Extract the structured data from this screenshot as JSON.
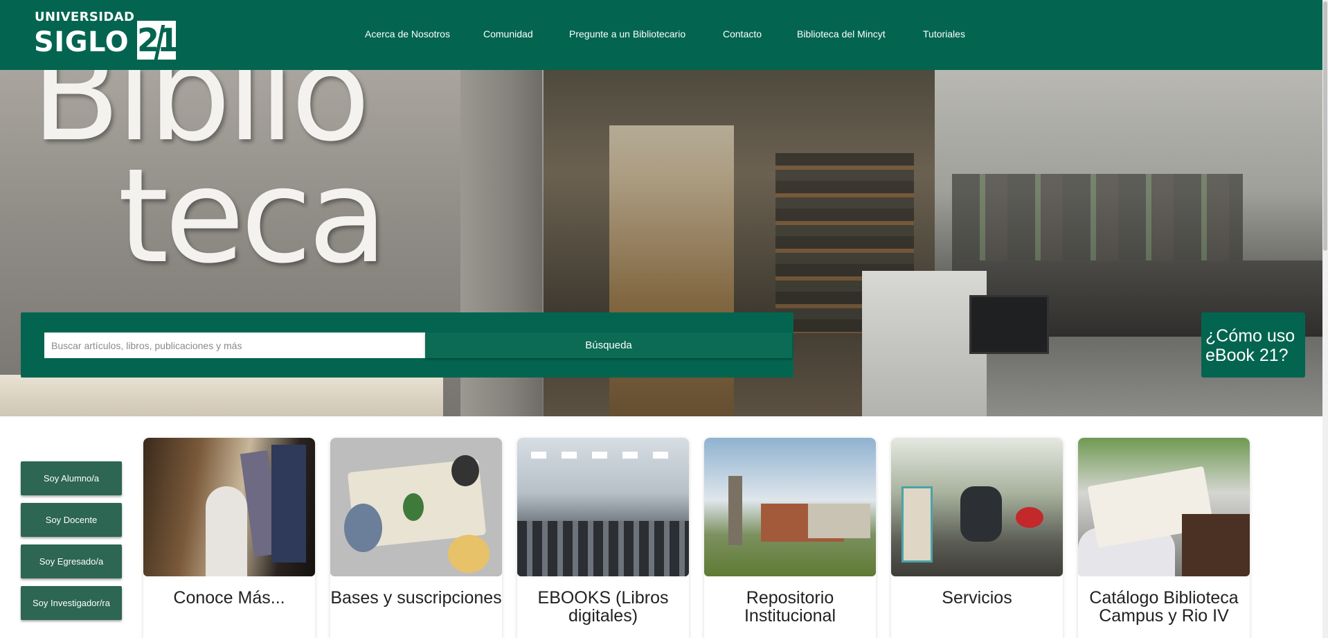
{
  "header": {
    "logo": {
      "line1": "UNIVERSIDAD",
      "line2": "SIGLO",
      "badge": "21"
    },
    "nav": [
      {
        "label": "Acerca de Nosotros"
      },
      {
        "label": "Comunidad"
      },
      {
        "label": "Pregunte a un Bibliotecario"
      },
      {
        "label": "Contacto"
      },
      {
        "label": "Biblioteca del Mincyt"
      },
      {
        "label": "Tutoriales"
      }
    ]
  },
  "hero": {
    "wall_text_line1": "Biblio",
    "wall_text_line2": "teca",
    "search": {
      "placeholder": "Buscar artículos, libros, publicaciones y más",
      "button_label": "Búsqueda"
    },
    "ebook_help_label": "¿Cómo uso eBook 21?"
  },
  "roles": [
    {
      "label": "Soy Alumno/a"
    },
    {
      "label": "Soy Docente"
    },
    {
      "label": "Soy Egresado/a"
    },
    {
      "label": "Soy Investigador/ra"
    }
  ],
  "cards": [
    {
      "title": "Conoce Más..."
    },
    {
      "title": "Bases y suscripciones"
    },
    {
      "title": "EBOOKS (Libros digitales)"
    },
    {
      "title": "Repositorio Institucional"
    },
    {
      "title": "Servicios"
    },
    {
      "title": "Catálogo Biblioteca Campus y Rio IV"
    }
  ],
  "colors": {
    "brand_green": "#03654f",
    "role_button": "#2d6653",
    "white": "#ffffff"
  }
}
